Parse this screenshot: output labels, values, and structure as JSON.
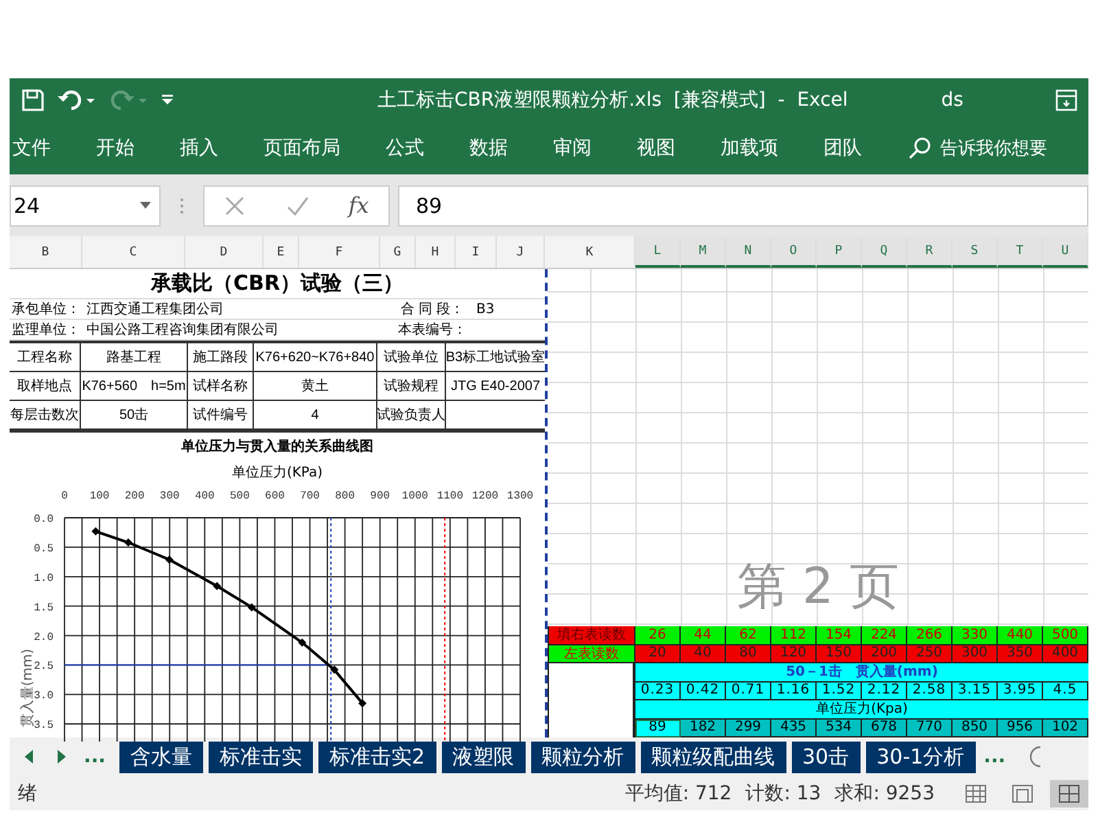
{
  "title_bar": {
    "title": "土工标击CBR液塑限颗粒分析.xls  [兼容模式]  -  Excel",
    "user": "ds",
    "redo_disabled": true
  },
  "ribbon_tabs": [
    "文件",
    "开始",
    "插入",
    "页面布局",
    "公式",
    "数据",
    "审阅",
    "视图",
    "加载项",
    "团队"
  ],
  "tell_me": "告诉我你想要",
  "formula_bar": {
    "name_box": "24",
    "function_label": "fx",
    "value": "89"
  },
  "columns": [
    {
      "label": "B",
      "selected": false
    },
    {
      "label": "C",
      "selected": false
    },
    {
      "label": "D",
      "selected": false
    },
    {
      "label": "E",
      "selected": false
    },
    {
      "label": "F",
      "selected": false
    },
    {
      "label": "G",
      "selected": false
    },
    {
      "label": "H",
      "selected": false
    },
    {
      "label": "I",
      "selected": false
    },
    {
      "label": "J",
      "selected": false
    },
    {
      "label": "K",
      "selected": false
    },
    {
      "label": "L",
      "selected": true
    },
    {
      "label": "M",
      "selected": true
    },
    {
      "label": "N",
      "selected": true
    },
    {
      "label": "O",
      "selected": true
    },
    {
      "label": "P",
      "selected": true
    },
    {
      "label": "Q",
      "selected": true
    },
    {
      "label": "R",
      "selected": true
    },
    {
      "label": "S",
      "selected": true
    },
    {
      "label": "T",
      "selected": true
    },
    {
      "label": "U",
      "selected": true
    }
  ],
  "form": {
    "title": "承载比（CBR）试验（三）",
    "header_rows": [
      {
        "label": "承包单位：",
        "value": "江西交通工程集团公司",
        "label_2": "合 同 段：",
        "value_2": "B3"
      },
      {
        "label": "监理单位：",
        "value": "中国公路工程咨询集团有限公司",
        "label_2": "本表编号：",
        "value_2": ""
      }
    ],
    "info_rows": [
      [
        "工程名称",
        "路基工程",
        "施工路段",
        "K76+620~K76+840",
        "试验单位",
        "B3标工地试验室"
      ],
      [
        "取样地点",
        "K76+560　h=5m",
        "试样名称",
        "黄土",
        "试验规程",
        "JTG E40-2007"
      ],
      [
        "每层击数次",
        "50击",
        "试件编号",
        "4",
        "试验负责人",
        ""
      ]
    ],
    "chart_data": {
      "type": "line",
      "title": "单位压力与贯入量的关系曲线图",
      "xlabel": "单位压力(KPa)",
      "ylabel": "贯入量(mm)",
      "x": [
        89,
        182,
        299,
        435,
        534,
        678,
        770,
        850
      ],
      "grid": true,
      "series": [
        {
          "color": "#000000",
          "marker": "diamond",
          "values": [
            0.23,
            0.42,
            0.71,
            1.16,
            1.52,
            2.12,
            2.58,
            3.15
          ]
        }
      ],
      "xlim": [
        0,
        1300
      ],
      "ylim": [
        3.8,
        0
      ],
      "xticks": [
        0,
        100,
        200,
        300,
        400,
        500,
        600,
        700,
        800,
        900,
        1000,
        1100,
        1200,
        1300
      ],
      "yticks": [
        {
          "value": 0,
          "label": "0.0"
        },
        {
          "value": 0.5,
          "label": "0.5"
        },
        {
          "value": 1,
          "label": "1.0"
        },
        {
          "value": 1.5,
          "label": "1.5"
        },
        {
          "value": 2,
          "label": "2.0"
        },
        {
          "value": 2.5,
          "label": "2.5"
        },
        {
          "value": 3,
          "label": "3.0"
        },
        {
          "value": 3.5,
          "label": "3.5"
        }
      ],
      "ref_lines": [
        {
          "axis": "x",
          "value": 760,
          "color": "#2040c0"
        },
        {
          "axis": "y",
          "value": 2.5,
          "color": "#2040c0"
        },
        {
          "axis": "x",
          "value": 1085,
          "color": "#ff0000"
        }
      ]
    }
  },
  "page_label": "第 2 页",
  "readings": [
    {
      "kind": "right",
      "label": "填右表读数",
      "values": [
        "26",
        "44",
        "62",
        "112",
        "154",
        "224",
        "266",
        "330",
        "440",
        "500"
      ]
    },
    {
      "kind": "left",
      "label": "左表读数",
      "values": [
        "20",
        "40",
        "80",
        "120",
        "150",
        "200",
        "250",
        "300",
        "350",
        "400"
      ]
    }
  ],
  "penetration": {
    "heading": "50－1击　贯入量(mm)",
    "values": [
      "0.23",
      "0.42",
      "0.71",
      "1.16",
      "1.52",
      "2.12",
      "2.58",
      "3.15",
      "3.95",
      "4.5"
    ]
  },
  "pressure": {
    "heading": "单位压力(Kpa)",
    "cells": [
      {
        "value": "89",
        "selected": true
      },
      {
        "value": "182",
        "selected": false
      },
      {
        "value": "299",
        "selected": false
      },
      {
        "value": "435",
        "selected": false
      },
      {
        "value": "534",
        "selected": false
      },
      {
        "value": "678",
        "selected": false
      },
      {
        "value": "770",
        "selected": false
      },
      {
        "value": "850",
        "selected": false
      },
      {
        "value": "956",
        "selected": false
      },
      {
        "value": "102",
        "selected": false
      }
    ]
  },
  "sheet_nav": {
    "more_left": "...",
    "more_right": "..."
  },
  "sheet_tabs": [
    "含水量",
    "标准击实",
    "标准击实2",
    "液塑限",
    "颗粒分析",
    "颗粒级配曲线",
    "30击",
    "30-1分析"
  ],
  "status_bar": {
    "ready": "绪",
    "average": "平均值: 712",
    "count": "计数: 13",
    "sum": "求和: 9253",
    "views": [
      {
        "kind": "normal",
        "selected": false
      },
      {
        "kind": "page_layout",
        "selected": false
      },
      {
        "kind": "page_break",
        "selected": true
      }
    ]
  }
}
